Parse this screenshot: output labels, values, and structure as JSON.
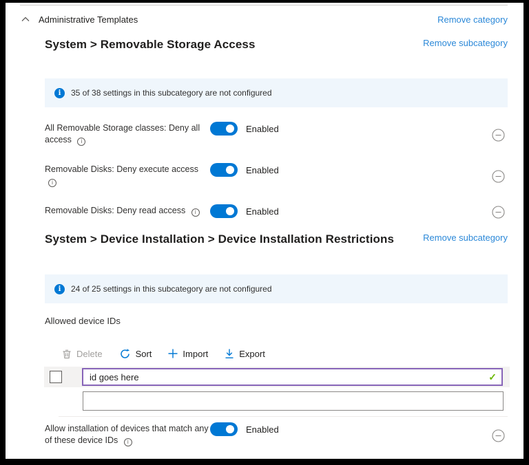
{
  "category_header": {
    "label": "Administrative Templates",
    "remove_label": "Remove category",
    "collapse_icon": "chevron-up"
  },
  "sections": [
    {
      "title": "System > Removable Storage Access",
      "remove_label": "Remove subcategory",
      "banner": "35 of 38 settings in this subcategory are not configured",
      "settings": [
        {
          "label": "All Removable Storage classes: Deny all access",
          "state": "Enabled",
          "toggle_on": true
        },
        {
          "label": "Removable Disks: Deny execute access",
          "state": "Enabled",
          "toggle_on": true
        },
        {
          "label": "Removable Disks: Deny read access",
          "state": "Enabled",
          "toggle_on": true
        }
      ]
    },
    {
      "title": "System > Device Installation > Device Installation Restrictions",
      "remove_label": "Remove subcategory",
      "banner": "24 of 25 settings in this subcategory are not configured",
      "list_editor": {
        "label": "Allowed device IDs",
        "toolbar": [
          {
            "label": "Delete",
            "icon": "trash-icon",
            "disabled": true
          },
          {
            "label": "Sort",
            "icon": "sort-icon",
            "disabled": false
          },
          {
            "label": "Import",
            "icon": "plus-icon",
            "disabled": false
          },
          {
            "label": "Export",
            "icon": "download-icon",
            "disabled": false
          }
        ],
        "rows": [
          {
            "value": "id goes here",
            "valid": true,
            "checked": false
          },
          {
            "value": ""
          }
        ]
      },
      "settings": [
        {
          "label": "Allow installation of devices that match any of these device IDs",
          "state": "Enabled",
          "toggle_on": true
        }
      ]
    }
  ],
  "icons": {
    "checkmark": "✓",
    "info": "i"
  },
  "colors": {
    "link": "#2b88d8",
    "accent": "#0078d4",
    "banner_bg": "#eff6fc",
    "valid_input_border": "#8764b8",
    "valid_check_green": "#6bb700",
    "text_primary": "#201f1e",
    "text_secondary": "#605e5c",
    "disabled_text": "#a19f9d",
    "frame_border": "#000000"
  }
}
